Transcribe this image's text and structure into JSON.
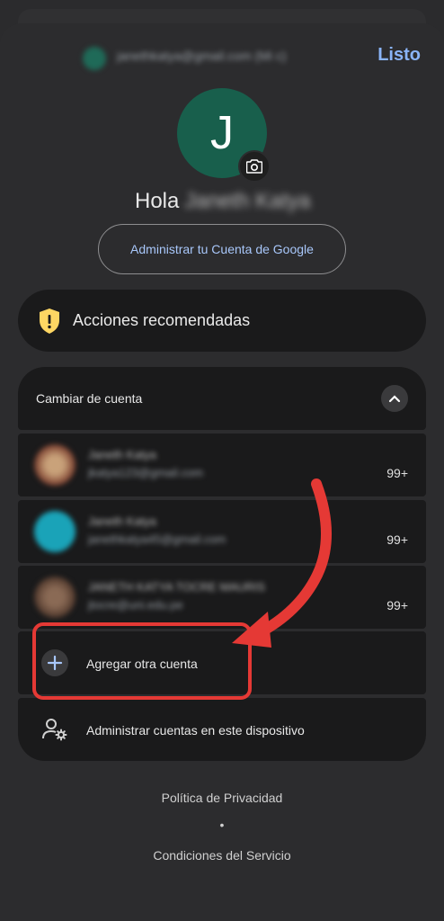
{
  "header": {
    "account_email": "janethkatya@gmail.com (Mi c)",
    "done_label": "Listo"
  },
  "profile": {
    "avatar_letter": "J",
    "greeting": "Hola",
    "name": "Janeth Katya",
    "manage_account_label": "Administrar tu Cuenta de Google"
  },
  "recommended": {
    "label": "Acciones recomendadas"
  },
  "accounts": {
    "section_label": "Cambiar de cuenta",
    "items": [
      {
        "name": "Janeth Katya",
        "email": "jkatya123@gmail.com",
        "badge": "99+",
        "avatar_color": "#7a3e2e"
      },
      {
        "name": "Janeth Katya",
        "email": "janethkatya45@gmail.com",
        "badge": "99+",
        "avatar_color": "#1aa3b8"
      },
      {
        "name": "JANETH KATYA TOCRE MAURIS",
        "email": "jtocre@uni.edu.pe",
        "badge": "99+",
        "avatar_color": "#6b4a3a"
      }
    ],
    "add_account_label": "Agregar otra cuenta",
    "manage_device_label": "Administrar cuentas en este dispositivo"
  },
  "footer": {
    "privacy_label": "Política de Privacidad",
    "separator": "•",
    "terms_label": "Condiciones del Servicio"
  },
  "colors": {
    "accent_blue": "#8ab4f8",
    "avatar_green": "#185f4c",
    "highlight_red": "#e53935",
    "warning_yellow": "#fdd663"
  }
}
